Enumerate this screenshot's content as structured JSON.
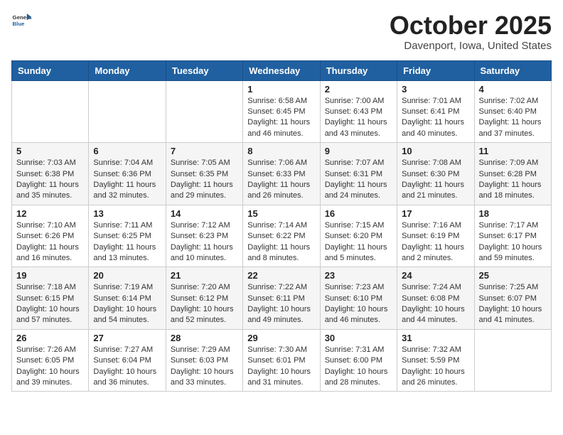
{
  "header": {
    "logo_general": "General",
    "logo_blue": "Blue",
    "month_title": "October 2025",
    "location": "Davenport, Iowa, United States"
  },
  "weekdays": [
    "Sunday",
    "Monday",
    "Tuesday",
    "Wednesday",
    "Thursday",
    "Friday",
    "Saturday"
  ],
  "weeks": [
    [
      {
        "day": "",
        "content": ""
      },
      {
        "day": "",
        "content": ""
      },
      {
        "day": "",
        "content": ""
      },
      {
        "day": "1",
        "content": "Sunrise: 6:58 AM\nSunset: 6:45 PM\nDaylight: 11 hours and 46 minutes."
      },
      {
        "day": "2",
        "content": "Sunrise: 7:00 AM\nSunset: 6:43 PM\nDaylight: 11 hours and 43 minutes."
      },
      {
        "day": "3",
        "content": "Sunrise: 7:01 AM\nSunset: 6:41 PM\nDaylight: 11 hours and 40 minutes."
      },
      {
        "day": "4",
        "content": "Sunrise: 7:02 AM\nSunset: 6:40 PM\nDaylight: 11 hours and 37 minutes."
      }
    ],
    [
      {
        "day": "5",
        "content": "Sunrise: 7:03 AM\nSunset: 6:38 PM\nDaylight: 11 hours and 35 minutes."
      },
      {
        "day": "6",
        "content": "Sunrise: 7:04 AM\nSunset: 6:36 PM\nDaylight: 11 hours and 32 minutes."
      },
      {
        "day": "7",
        "content": "Sunrise: 7:05 AM\nSunset: 6:35 PM\nDaylight: 11 hours and 29 minutes."
      },
      {
        "day": "8",
        "content": "Sunrise: 7:06 AM\nSunset: 6:33 PM\nDaylight: 11 hours and 26 minutes."
      },
      {
        "day": "9",
        "content": "Sunrise: 7:07 AM\nSunset: 6:31 PM\nDaylight: 11 hours and 24 minutes."
      },
      {
        "day": "10",
        "content": "Sunrise: 7:08 AM\nSunset: 6:30 PM\nDaylight: 11 hours and 21 minutes."
      },
      {
        "day": "11",
        "content": "Sunrise: 7:09 AM\nSunset: 6:28 PM\nDaylight: 11 hours and 18 minutes."
      }
    ],
    [
      {
        "day": "12",
        "content": "Sunrise: 7:10 AM\nSunset: 6:26 PM\nDaylight: 11 hours and 16 minutes."
      },
      {
        "day": "13",
        "content": "Sunrise: 7:11 AM\nSunset: 6:25 PM\nDaylight: 11 hours and 13 minutes."
      },
      {
        "day": "14",
        "content": "Sunrise: 7:12 AM\nSunset: 6:23 PM\nDaylight: 11 hours and 10 minutes."
      },
      {
        "day": "15",
        "content": "Sunrise: 7:14 AM\nSunset: 6:22 PM\nDaylight: 11 hours and 8 minutes."
      },
      {
        "day": "16",
        "content": "Sunrise: 7:15 AM\nSunset: 6:20 PM\nDaylight: 11 hours and 5 minutes."
      },
      {
        "day": "17",
        "content": "Sunrise: 7:16 AM\nSunset: 6:19 PM\nDaylight: 11 hours and 2 minutes."
      },
      {
        "day": "18",
        "content": "Sunrise: 7:17 AM\nSunset: 6:17 PM\nDaylight: 10 hours and 59 minutes."
      }
    ],
    [
      {
        "day": "19",
        "content": "Sunrise: 7:18 AM\nSunset: 6:15 PM\nDaylight: 10 hours and 57 minutes."
      },
      {
        "day": "20",
        "content": "Sunrise: 7:19 AM\nSunset: 6:14 PM\nDaylight: 10 hours and 54 minutes."
      },
      {
        "day": "21",
        "content": "Sunrise: 7:20 AM\nSunset: 6:12 PM\nDaylight: 10 hours and 52 minutes."
      },
      {
        "day": "22",
        "content": "Sunrise: 7:22 AM\nSunset: 6:11 PM\nDaylight: 10 hours and 49 minutes."
      },
      {
        "day": "23",
        "content": "Sunrise: 7:23 AM\nSunset: 6:10 PM\nDaylight: 10 hours and 46 minutes."
      },
      {
        "day": "24",
        "content": "Sunrise: 7:24 AM\nSunset: 6:08 PM\nDaylight: 10 hours and 44 minutes."
      },
      {
        "day": "25",
        "content": "Sunrise: 7:25 AM\nSunset: 6:07 PM\nDaylight: 10 hours and 41 minutes."
      }
    ],
    [
      {
        "day": "26",
        "content": "Sunrise: 7:26 AM\nSunset: 6:05 PM\nDaylight: 10 hours and 39 minutes."
      },
      {
        "day": "27",
        "content": "Sunrise: 7:27 AM\nSunset: 6:04 PM\nDaylight: 10 hours and 36 minutes."
      },
      {
        "day": "28",
        "content": "Sunrise: 7:29 AM\nSunset: 6:03 PM\nDaylight: 10 hours and 33 minutes."
      },
      {
        "day": "29",
        "content": "Sunrise: 7:30 AM\nSunset: 6:01 PM\nDaylight: 10 hours and 31 minutes."
      },
      {
        "day": "30",
        "content": "Sunrise: 7:31 AM\nSunset: 6:00 PM\nDaylight: 10 hours and 28 minutes."
      },
      {
        "day": "31",
        "content": "Sunrise: 7:32 AM\nSunset: 5:59 PM\nDaylight: 10 hours and 26 minutes."
      },
      {
        "day": "",
        "content": ""
      }
    ]
  ]
}
